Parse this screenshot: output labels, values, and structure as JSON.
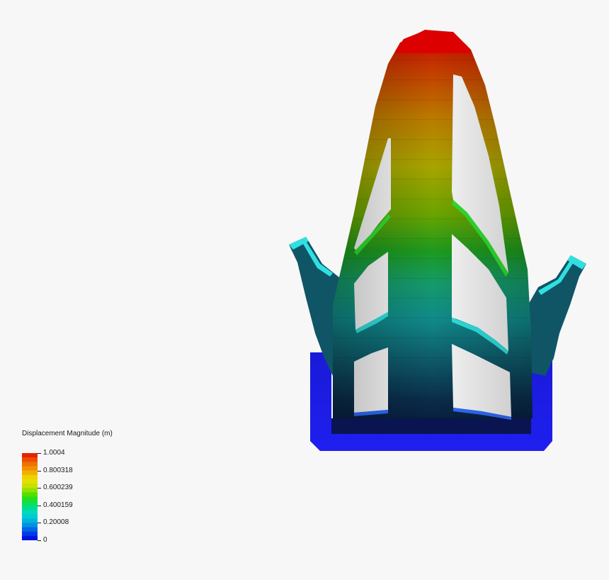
{
  "legend": {
    "title": "Displacement Magnitude (m)",
    "min": 0,
    "max": 1.0004,
    "ticks": [
      {
        "label": "1.0004",
        "value": 1.0004
      },
      {
        "label": "0.800318",
        "value": 0.800318
      },
      {
        "label": "0.600239",
        "value": 0.600239
      },
      {
        "label": "0.400159",
        "value": 0.400159
      },
      {
        "label": "0.20008",
        "value": 0.20008
      },
      {
        "label": "0",
        "value": 0
      }
    ],
    "band_count": 20,
    "colormap": [
      "#0000e0",
      "#0050e8",
      "#00a8e0",
      "#00d8d0",
      "#00e070",
      "#30e000",
      "#b8e000",
      "#f0e000",
      "#f0a000",
      "#f06000",
      "#e01000"
    ]
  },
  "model": {
    "colors": {
      "base": "#1a1ae6",
      "low": "#0b2a4a",
      "mid": "#14a0a0",
      "green": "#1ea01e",
      "yellow": "#b0b000",
      "orange": "#c86400",
      "top": "#cc0000",
      "edge_highlight": "#30e0e0"
    }
  }
}
